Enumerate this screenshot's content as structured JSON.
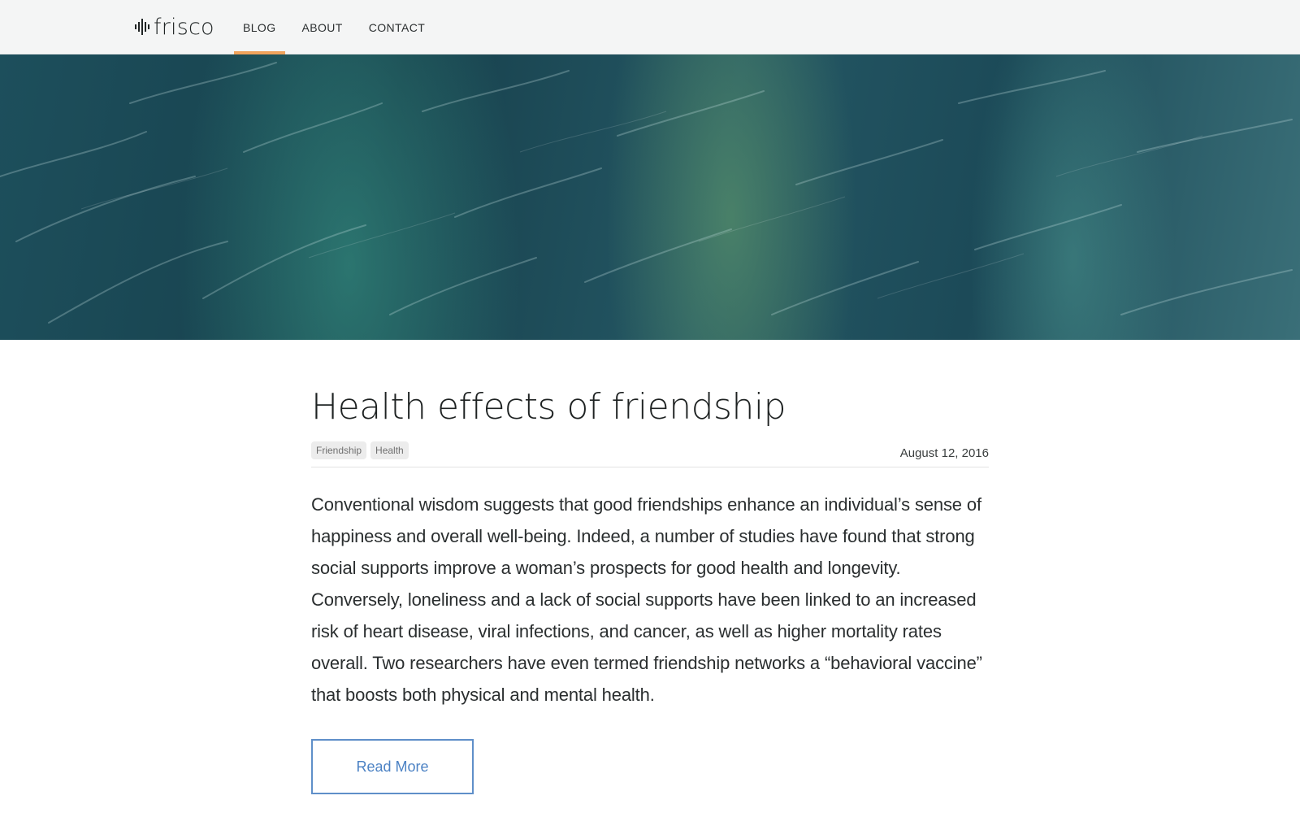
{
  "header": {
    "logo_text": "frisco",
    "nav": [
      {
        "label": "BLOG",
        "active": true
      },
      {
        "label": "ABOUT",
        "active": false
      },
      {
        "label": "CONTACT",
        "active": false
      }
    ],
    "accent_color": "#f0a35c"
  },
  "hero": {
    "icon": "ocean-water-image"
  },
  "post": {
    "title": "Health effects of friendship",
    "tags": [
      "Friendship",
      "Health"
    ],
    "date": "August 12, 2016",
    "body": "Conventional wisdom suggests that good friendships enhance an individual’s sense of happiness and overall well-being. Indeed, a number of studies have found that strong social supports improve a woman’s prospects for good health and longevity. Conversely, loneliness and a lack of social supports have been linked to an increased risk of heart disease, viral infections, and cancer, as well as higher mortality rates overall. Two researchers have even termed friendship networks a “behavioral vaccine” that boosts both physical and mental health.",
    "read_more_label": "Read More",
    "button_color": "#5f8fc9"
  }
}
